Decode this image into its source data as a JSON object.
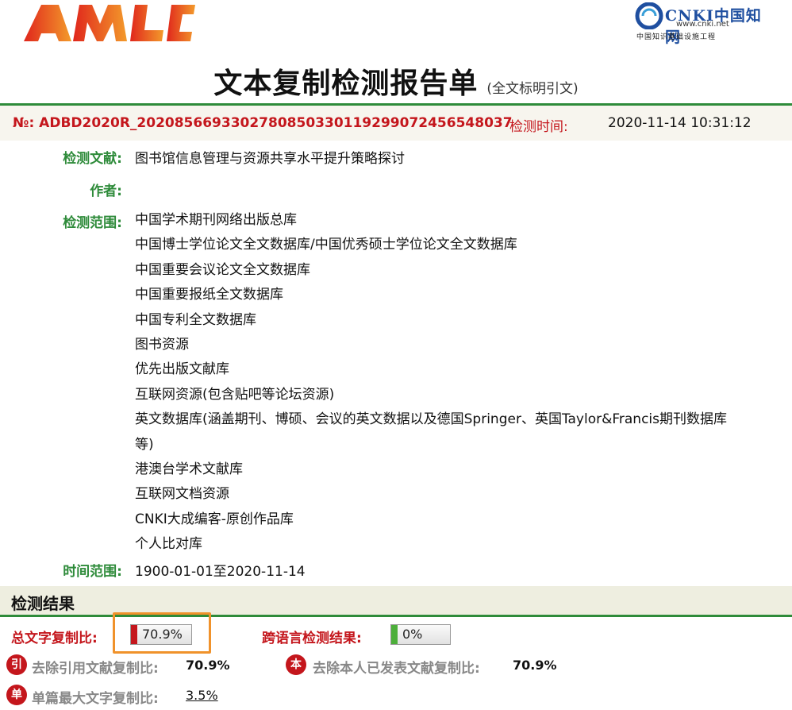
{
  "header": {
    "logo_left_text": "AMLC",
    "cnki_name": "CNKI中国知网",
    "cnki_url": "www.cnki.net",
    "cnki_subtitle": "中国知识基础设施工程"
  },
  "report": {
    "title": "文本复制检测报告单",
    "subtitle": "(全文标明引文)",
    "number": "№: ADBD2020R_2020856693302780850330119299072456548037",
    "time_label": "检测时间:",
    "time_value": "2020-11-14 10:31:12"
  },
  "fields": {
    "doc_label": "检测文献:",
    "doc_value": "图书馆信息管理与资源共享水平提升策略探讨",
    "author_label": "作者:",
    "author_value": "",
    "scope_label": "检测范围:",
    "scope_items": [
      "中国学术期刊网络出版总库",
      "中国博士学位论文全文数据库/中国优秀硕士学位论文全文数据库",
      "中国重要会议论文全文数据库",
      "中国重要报纸全文数据库",
      "中国专利全文数据库",
      "图书资源",
      "优先出版文献库",
      "互联网资源(包含贴吧等论坛资源)",
      "英文数据库(涵盖期刊、博硕、会议的英文数据以及德国Springer、英国Taylor&Francis期刊数据库",
      "等)",
      "港澳台学术文献库",
      "互联网文档资源",
      "CNKI大成编客-原创作品库",
      "个人比对库"
    ],
    "range_label": "时间范围:",
    "range_value": "1900-01-01至2020-11-14"
  },
  "results": {
    "section_title": "检测结果",
    "total_label": "总文字复制比:",
    "total_value": "70.9%",
    "total_fraction": 0.709,
    "cross_label": "跨语言检测结果:",
    "cross_value": "0%",
    "cross_fraction": 0,
    "exclude_ref_badge": "引",
    "exclude_ref_label": "去除引用文献复制比:",
    "exclude_ref_value": "70.9%",
    "exclude_self_badge": "本",
    "exclude_self_label": "去除本人已发表文献复制比:",
    "exclude_self_value": "70.9%",
    "single_max_badge": "单",
    "single_max_label": "单篇最大文字复制比:",
    "single_max_value": "3.5%"
  },
  "colors": {
    "accent_green": "#2e8b3a",
    "accent_red": "#c4161c",
    "highlight_orange": "#f0922b"
  }
}
